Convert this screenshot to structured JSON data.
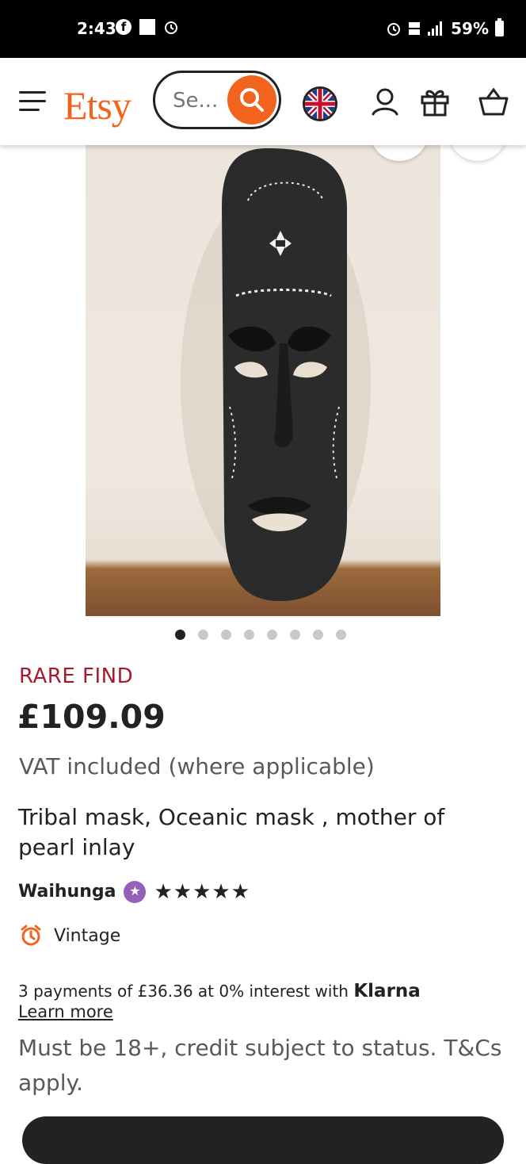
{
  "status_bar": {
    "time": "2:43",
    "battery": "59%",
    "icons": [
      "facebook-icon",
      "gallery-icon",
      "alarm-icon",
      "alarm-icon",
      "lte-icon",
      "signal-icon",
      "battery-icon"
    ]
  },
  "header": {
    "logo": "Etsy",
    "search_placeholder": "Se...",
    "icons": [
      "menu-icon",
      "search-icon",
      "uk-flag-icon",
      "account-icon",
      "gift-icon",
      "basket-icon"
    ],
    "accent_color": "#f1641e"
  },
  "gallery": {
    "dot_count": 8,
    "active_index": 0
  },
  "listing": {
    "badge": "RARE FIND",
    "price": "£109.09",
    "vat_note": "VAT included (where applicable)",
    "title": "Tribal mask, Oceanic mask , mother of pearl inlay",
    "seller": "Waihunga",
    "rating_stars": 5,
    "stars_text": "★★★★★",
    "condition": "Vintage",
    "badge_color": "#a61a2e"
  },
  "klarna": {
    "text": "3 payments of £36.36 at 0% interest with ",
    "brand": "Klarna",
    "learn_more": "Learn more",
    "disclaimer": "Must be 18+, credit subject to status. T&Cs apply."
  }
}
